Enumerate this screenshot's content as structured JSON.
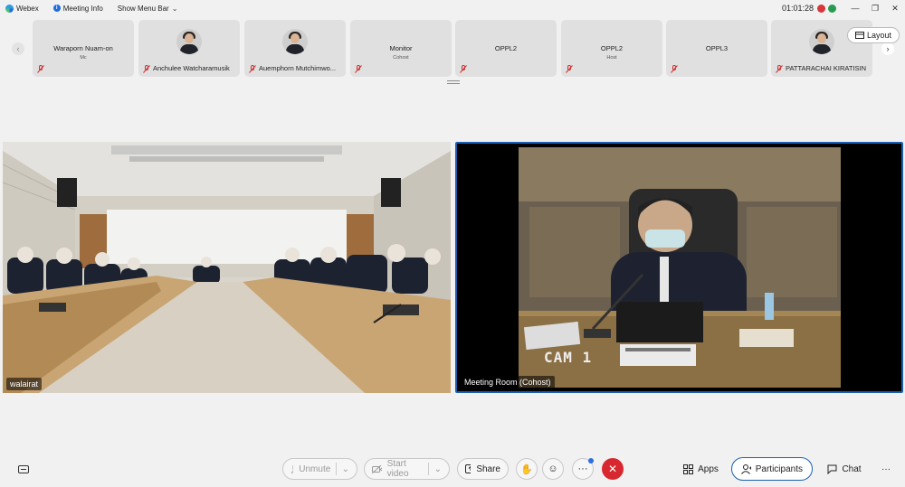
{
  "topbar": {
    "app_name": "Webex",
    "meeting_info": "Meeting Info",
    "show_menu_bar": "Show Menu Bar",
    "timer": "01:01:28",
    "window_controls": [
      "minimize-icon",
      "restore-icon",
      "close-icon"
    ]
  },
  "participants_strip": [
    {
      "name": "Waraporn Nuam-on",
      "role": "Mc",
      "muted": true
    },
    {
      "name": "Anchulee Watcharamusik",
      "role": "",
      "muted": true,
      "has_avatar": true
    },
    {
      "name": "Auemphorn Mutchimwo...",
      "role": "",
      "muted": true,
      "has_avatar": true
    },
    {
      "name": "Monitor",
      "role": "Cohost",
      "muted": true
    },
    {
      "name": "OPPL2",
      "role": "",
      "muted": true
    },
    {
      "name": "OPPL2",
      "role": "Host",
      "muted": true
    },
    {
      "name": "OPPL3",
      "role": "",
      "muted": true
    },
    {
      "name": "PATTARACHAI KIRATISIN",
      "role": "",
      "muted": true,
      "has_avatar": true
    }
  ],
  "layout_button": "Layout",
  "videos": {
    "left_label": "walairat",
    "right_label": "Meeting Room (Cohost)",
    "cam_overlay": "CAM  1"
  },
  "toolbar": {
    "unmute": "Unmute",
    "start_video": "Start video",
    "share": "Share",
    "apps": "Apps",
    "participants": "Participants",
    "chat": "Chat",
    "more": "···"
  },
  "colors": {
    "end_call": "#d8282f",
    "accent": "#1c5fb0",
    "muted_icon": "#d03030"
  }
}
